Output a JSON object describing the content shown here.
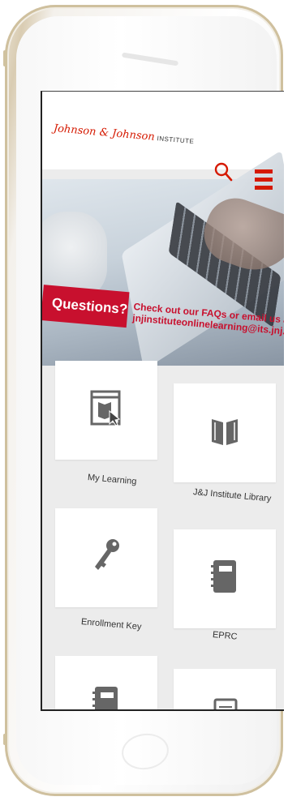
{
  "brand": {
    "logo_text": "Johnson & Johnson",
    "logo_sub": "INSTITUTE",
    "accent_color": "#d51900"
  },
  "header": {
    "search_icon": "search-icon",
    "menu_icon": "hamburger-menu-icon"
  },
  "banner": {
    "badge": "Questions?",
    "message_line1": "Check out our FAQs or email us at:",
    "message_line2": "jnjinstituteonlinelearning@its.jnj.com"
  },
  "tiles": [
    {
      "label": "My Learning",
      "icon": "my-learning-icon"
    },
    {
      "label": "J&J Institute Library",
      "icon": "book-icon"
    },
    {
      "label": "Enrollment Key",
      "icon": "key-icon"
    },
    {
      "label": "EPRC",
      "icon": "notebook-icon"
    },
    {
      "label": "",
      "icon": "notebook-icon"
    },
    {
      "label": "",
      "icon": "document-icon"
    }
  ]
}
